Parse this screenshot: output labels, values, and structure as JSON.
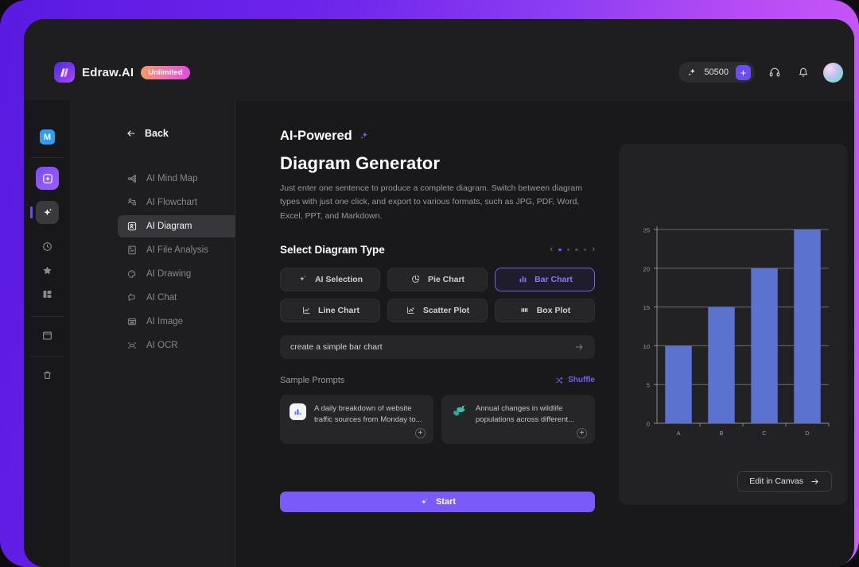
{
  "header": {
    "brand_mark": "M",
    "brand_name": "Edraw.AI",
    "plan_badge": "Unlimited",
    "credits": "50500",
    "add_credits_label": "+",
    "support_icon": "headset-icon",
    "notifications_icon": "bell-icon",
    "avatar_name": "user-avatar"
  },
  "rail": {
    "badge": "M",
    "items": [
      {
        "name": "new-document",
        "icon": "plus-square-icon",
        "state": "purple"
      },
      {
        "name": "ai-tools",
        "icon": "sparkle-icon",
        "state": "active"
      },
      {
        "name": "recent",
        "icon": "clock-icon",
        "state": "idle"
      },
      {
        "name": "favorites",
        "icon": "star-icon",
        "state": "idle"
      },
      {
        "name": "templates",
        "icon": "templates-icon",
        "state": "idle"
      },
      {
        "name": "files",
        "icon": "folder-icon",
        "state": "idle"
      },
      {
        "name": "trash",
        "icon": "trash-icon",
        "state": "idle"
      }
    ]
  },
  "nav": {
    "back_label": "Back",
    "items": [
      {
        "label": "AI Mind Map",
        "icon": "mindmap-icon",
        "selected": false
      },
      {
        "label": "AI Flowchart",
        "icon": "flowchart-icon",
        "selected": false
      },
      {
        "label": "AI Diagram",
        "icon": "diagram-icon",
        "selected": true
      },
      {
        "label": "AI File Analysis",
        "icon": "file-chart-icon",
        "selected": false
      },
      {
        "label": "AI Drawing",
        "icon": "palette-icon",
        "selected": false
      },
      {
        "label": "AI Chat",
        "icon": "chat-icon",
        "selected": false
      },
      {
        "label": "AI Image",
        "icon": "image-icon",
        "selected": false
      },
      {
        "label": "AI OCR",
        "icon": "ocr-icon",
        "selected": false
      }
    ]
  },
  "main": {
    "eyebrow": "AI-Powered",
    "title": "Diagram Generator",
    "description": "Just enter one sentence to produce a complete diagram. Switch between diagram types with just one click, and export to various formats, such as JPG, PDF, Word, Excel, PPT, and Markdown.",
    "section_title": "Select Diagram Type",
    "carousel": {
      "prev": "‹",
      "next": "›",
      "dots": 4,
      "active_dot": 0
    },
    "types": [
      {
        "label": "AI Selection",
        "icon": "sparkle-icon",
        "selected": false
      },
      {
        "label": "Pie Chart",
        "icon": "pie-chart-icon",
        "selected": false
      },
      {
        "label": "Bar Chart",
        "icon": "bar-chart-icon",
        "selected": true
      },
      {
        "label": "Line Chart",
        "icon": "line-chart-icon",
        "selected": false
      },
      {
        "label": "Scatter Plot",
        "icon": "scatter-plot-icon",
        "selected": false
      },
      {
        "label": "Box Plot",
        "icon": "box-plot-icon",
        "selected": false
      }
    ],
    "prompt": {
      "value": "create a simple bar chart",
      "submit_icon": "arrow-right-icon"
    },
    "sample_prompts_label": "Sample Prompts",
    "shuffle_label": "Shuffle",
    "cards": [
      {
        "text": "A daily breakdown of website traffic sources from Monday to...",
        "icon": "bar-chart-color-icon",
        "add": "+"
      },
      {
        "text": "Annual changes in wildlife populations across different...",
        "icon": "leaf-icon",
        "add": "+"
      }
    ],
    "start_label": "Start",
    "start_icon": "sparkle-icon"
  },
  "preview": {
    "edit_label": "Edit in Canvas",
    "edit_icon": "arrow-right-icon"
  },
  "colors": {
    "accent": "#7a5af8",
    "bar": "#5b72cf",
    "badge_blue": "#2f9df4"
  },
  "chart_data": {
    "type": "bar",
    "categories": [
      "A",
      "B",
      "C",
      "D"
    ],
    "values": [
      10,
      15,
      20,
      25
    ],
    "title": "",
    "xlabel": "",
    "ylabel": "",
    "ylim": [
      0,
      25
    ],
    "yticks": [
      0,
      5,
      10,
      15,
      20,
      25
    ],
    "grid": true,
    "legend": "none"
  }
}
